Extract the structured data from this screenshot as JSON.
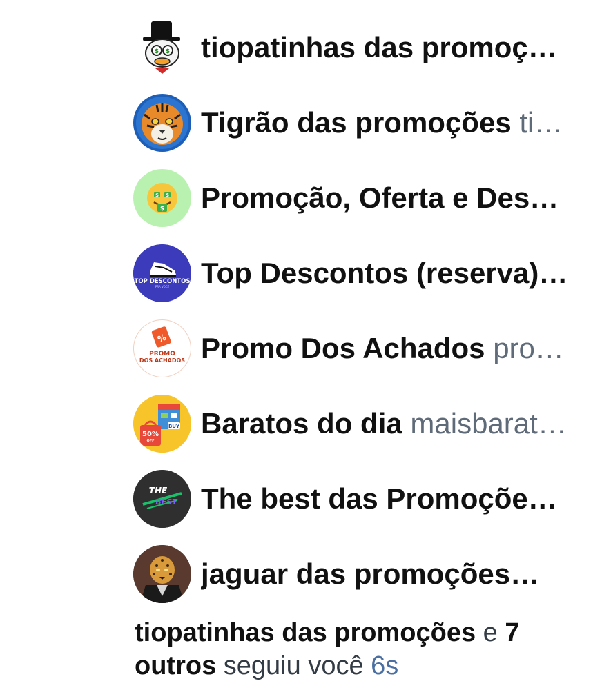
{
  "followers": [
    {
      "name": "tiopatinhas das promoç…",
      "handle": "",
      "avatar_icon": "scrooge-duck-avatar"
    },
    {
      "name": "Tigrão das promoções",
      "handle": "ti…",
      "avatar_icon": "tiger-avatar"
    },
    {
      "name": "Promoção, Oferta e Des…",
      "handle": "",
      "avatar_icon": "money-mouth-face-avatar"
    },
    {
      "name": "Top Descontos (reserva)…",
      "handle": "",
      "avatar_icon": "top-descontos-sneaker-logo",
      "avatar_text": "TOP DESCONTOS",
      "avatar_subtext": "PRA VOCÊ"
    },
    {
      "name": "Promo Dos Achados",
      "handle": "pro…",
      "avatar_icon": "promo-dos-achados-logo",
      "avatar_text": "PROMO",
      "avatar_subtext": "DOS ACHADOS"
    },
    {
      "name": "Baratos do dia",
      "handle": "maisbarat…",
      "avatar_icon": "shopping-store-avatar",
      "avatar_text": "50%",
      "avatar_subtext": "OFF",
      "avatar_tag": "BUY"
    },
    {
      "name": "The best das Promoçõe…",
      "handle": "",
      "avatar_icon": "the-best-logo",
      "avatar_text": "THE",
      "avatar_subtext": "BEST"
    },
    {
      "name": "jaguar das promoções…",
      "handle": "",
      "avatar_icon": "jaguar-avatar"
    }
  ],
  "notification": {
    "first_user": "tiopatinhas das promoções",
    "connector": "e",
    "others": "7 outros",
    "action": "seguiu você",
    "time": "6s"
  },
  "colors": {
    "name_text": "#111111",
    "handle_text": "#5f6b78",
    "time_text": "#4a6fa0",
    "background": "#ffffff"
  }
}
